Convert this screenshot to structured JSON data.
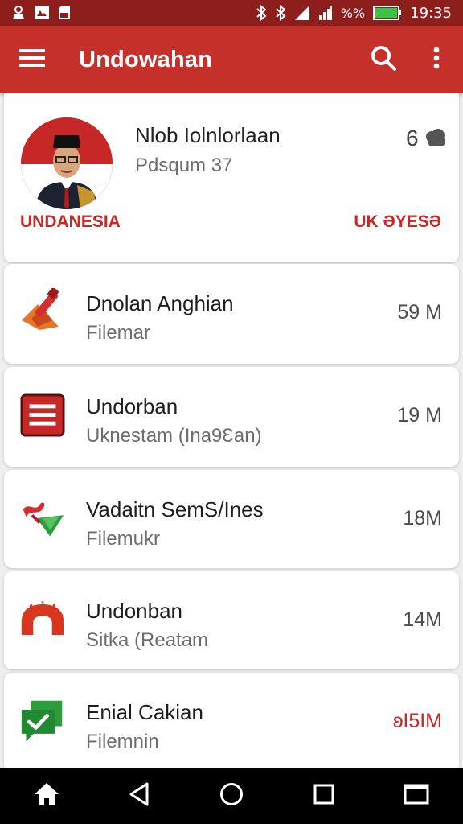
{
  "status_bar": {
    "battery": "%%",
    "time": "19:35",
    "icons": [
      "person-icon",
      "gallery-icon",
      "sd-card-icon",
      "bluetooth-icon",
      "bluetooth-icon",
      "signal-icon",
      "signal-icon",
      "battery-icon"
    ]
  },
  "app_bar": {
    "title": "Undowahan",
    "icons": [
      "menu-icon",
      "search-icon",
      "more-vert-icon"
    ],
    "color": "#c5302a"
  },
  "featured": {
    "title": "Nlob Iolnlorlaan",
    "subtitle": "Pdsqum 37",
    "count": "6",
    "country": "UNDANESIA",
    "tag": "UK ƏYESƏ"
  },
  "items": [
    {
      "title": "Dnolan Anghian",
      "subtitle": "Filemar",
      "size": "59 M",
      "icon": "brush-icon"
    },
    {
      "title": "Undorban",
      "subtitle": "Uknestam (Ina9Ɛan)",
      "size": "19 M",
      "icon": "list-icon"
    },
    {
      "title": "Vadaitn SemS/Ines",
      "subtitle": "Filemukr",
      "size": "18M",
      "icon": "flag-icon"
    },
    {
      "title": "Undonban",
      "subtitle": "Sitka (Reatam",
      "size": "14M",
      "icon": "arch-icon"
    },
    {
      "title": "Enial Cakian",
      "subtitle": "Filemnin",
      "size": "ʚI5IM",
      "icon": "chat-check-icon"
    }
  ],
  "nav_bar": {
    "icons": [
      "home-icon",
      "back-icon",
      "circle-home-icon",
      "recents-icon",
      "window-icon"
    ]
  },
  "colors": {
    "accent": "#c62828",
    "status_bar": "#8e1e1c"
  }
}
